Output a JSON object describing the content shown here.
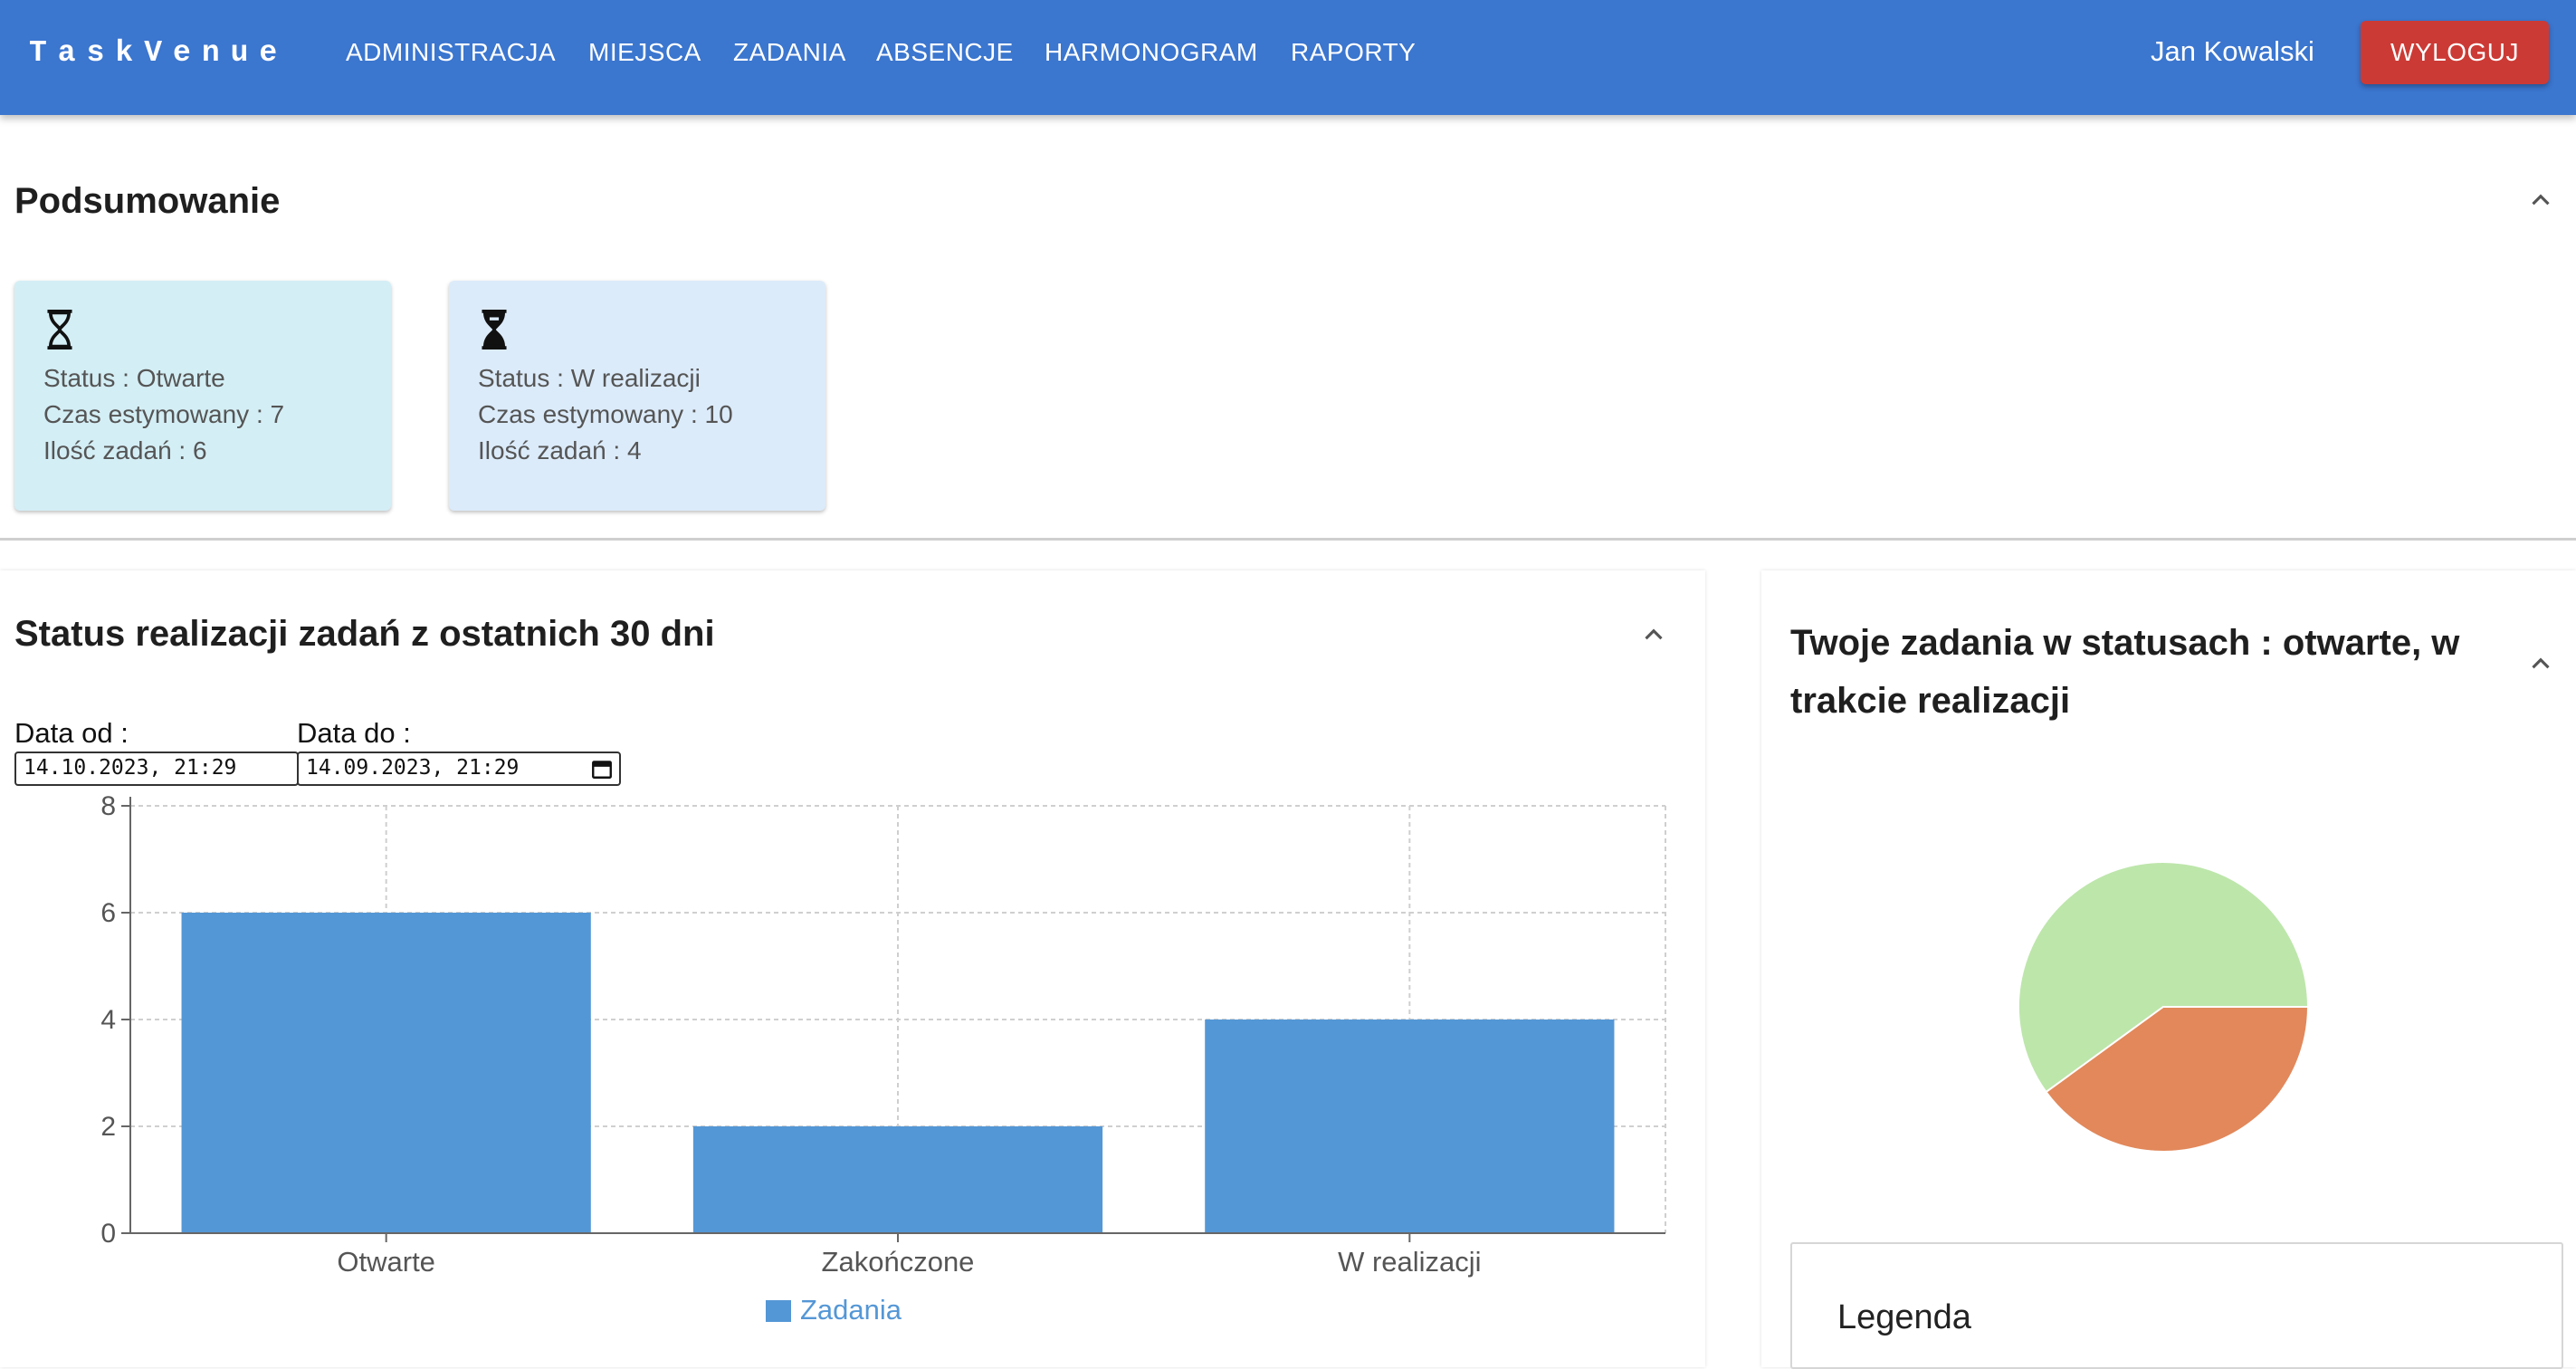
{
  "app": {
    "brand": "TaskVenue"
  },
  "nav": {
    "items": [
      "ADMINISTRACJA",
      "MIEJSCA",
      "ZADANIA",
      "ABSENCJE",
      "HARMONOGRAM",
      "RAPORTY"
    ]
  },
  "user": {
    "name": "Jan Kowalski",
    "logout_label": "WYLOGUJ"
  },
  "summary": {
    "title": "Podsumowanie",
    "cards": [
      {
        "status": "Status : Otwarte",
        "time": "Czas estymowany : 7",
        "count": "Ilość zadań : 6",
        "icon": "hourglass-empty-icon",
        "color": "#d4eef5"
      },
      {
        "status": "Status : W realizacji",
        "time": "Czas estymowany : 10",
        "count": "Ilość zadań : 4",
        "icon": "hourglass-full-icon",
        "color": "#dcebfa"
      }
    ]
  },
  "status_panel": {
    "title": "Status realizacji zadań z ostatnich 30 dni",
    "date_from_label": "Data od :",
    "date_to_label": "Data do :",
    "date_from_value": "14.10.2023, 21:29",
    "date_to_value": "14.09.2023, 21:29"
  },
  "pie_panel": {
    "title_line1": "Twoje zadania w statusach : otwarte, w",
    "title_line2": "trakcie realizacji",
    "legend_title": "Legenda"
  },
  "chart_data": [
    {
      "type": "bar",
      "categories": [
        "Otwarte",
        "Zakończone",
        "W realizacji"
      ],
      "series": [
        {
          "name": "Zadania",
          "values": [
            6,
            2,
            4
          ],
          "color": "#5497d6"
        }
      ],
      "yticks": [
        0,
        2,
        4,
        6,
        8
      ],
      "ylim": [
        0,
        8
      ],
      "grid": true,
      "legend_position": "bottom"
    },
    {
      "type": "pie",
      "values": [
        6,
        4
      ],
      "colors": [
        "#bde6ab",
        "#e2885b"
      ]
    }
  ]
}
